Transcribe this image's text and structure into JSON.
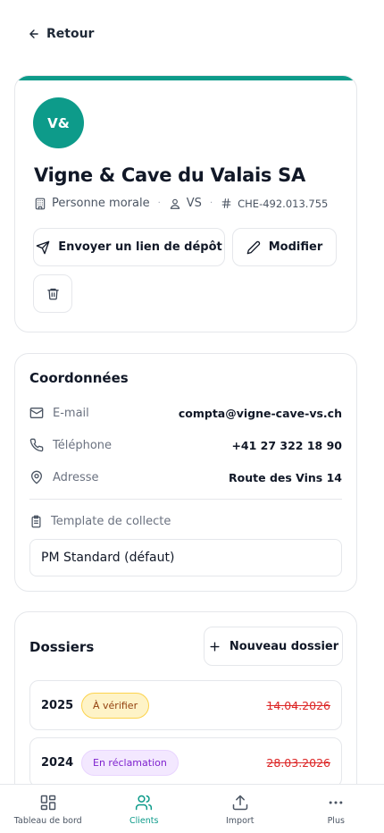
{
  "nav": {
    "back_label": "Retour"
  },
  "client": {
    "initials": "V&",
    "name": "Vigne & Cave du Valais SA",
    "type": "Personne morale",
    "canton": "VS",
    "uid": "CHE-492.013.755",
    "accent_color": "#0d9b8a"
  },
  "actions": {
    "send_label": "Envoyer un lien de dépôt",
    "edit_label": "Modifier"
  },
  "coordonnees": {
    "title": "Coordonnées",
    "email_label": "E-mail",
    "email_value": "compta@vigne-cave-vs.ch",
    "phone_label": "Téléphone",
    "phone_value": "+41 27 322 18 90",
    "address_label": "Adresse",
    "address_value": "Route des Vins 14",
    "template_label": "Template de collecte",
    "template_value": "PM Standard (défaut)"
  },
  "dossiers": {
    "title": "Dossiers",
    "new_label": "Nouveau dossier",
    "items": [
      {
        "year": "2025",
        "status": "À vérifier",
        "date": "14.04.2026"
      },
      {
        "year": "2024",
        "status": "En réclamation",
        "date": "28.03.2026"
      }
    ]
  },
  "tabs": [
    {
      "label": "Tableau de bord",
      "icon": "dashboard-icon"
    },
    {
      "label": "Clients",
      "icon": "users-icon",
      "active": true
    },
    {
      "label": "Import",
      "icon": "upload-icon"
    },
    {
      "label": "Plus",
      "icon": "more-icon"
    }
  ]
}
